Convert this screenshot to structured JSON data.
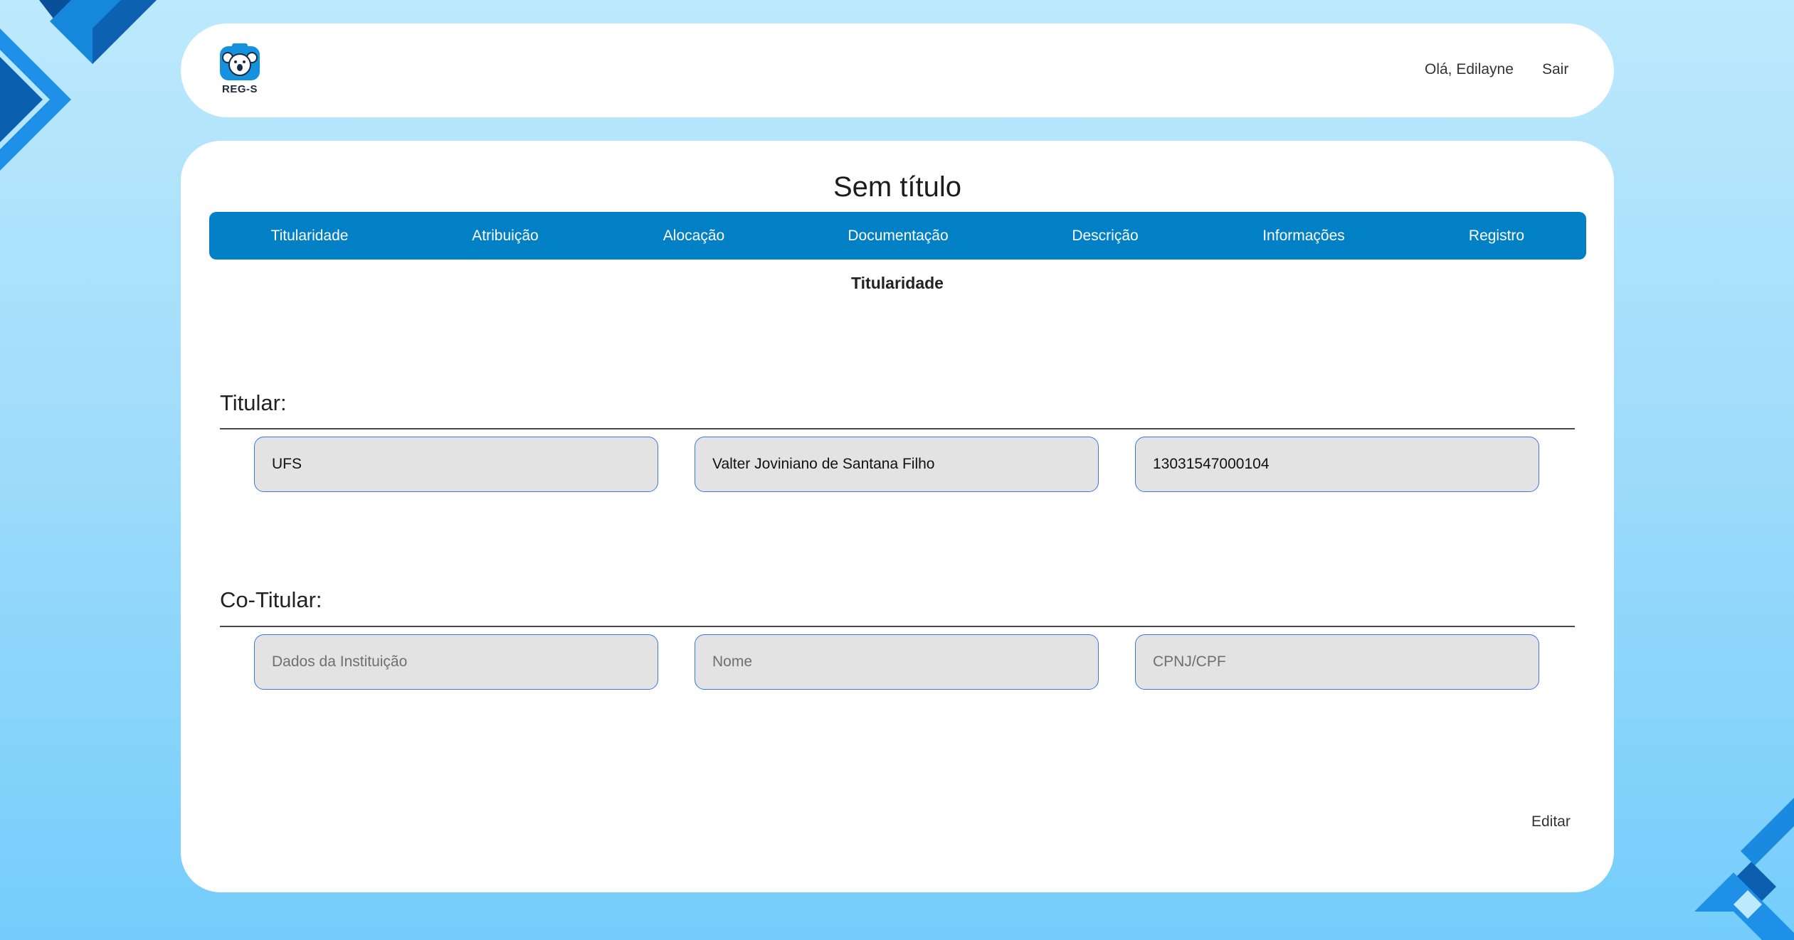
{
  "header": {
    "logo_text": "REG-S",
    "greeting": "Olá, Edilayne",
    "logout_label": "Sair"
  },
  "main": {
    "title": "Sem título",
    "tabs": [
      {
        "label": "Titularidade"
      },
      {
        "label": "Atribuição"
      },
      {
        "label": "Alocação"
      },
      {
        "label": "Documentação"
      },
      {
        "label": "Descrição"
      },
      {
        "label": "Informações"
      },
      {
        "label": "Registro"
      }
    ],
    "section_heading": "Titularidade",
    "titular": {
      "label": "Titular:",
      "institution": "UFS",
      "name": "Valter Joviniano de Santana Filho",
      "document": "13031547000104"
    },
    "cotitular": {
      "label": "Co-Titular:",
      "institution_placeholder": "Dados da Instituição",
      "name_placeholder": "Nome",
      "document_placeholder": "CPNJ/CPF"
    },
    "edit_label": "Editar"
  },
  "colors": {
    "accent": "#0180c6",
    "field_border": "#3a78e0",
    "field_background": "#e3e3e3",
    "page_background_top": "#bde9fd",
    "page_background_bottom": "#74cdfb"
  }
}
